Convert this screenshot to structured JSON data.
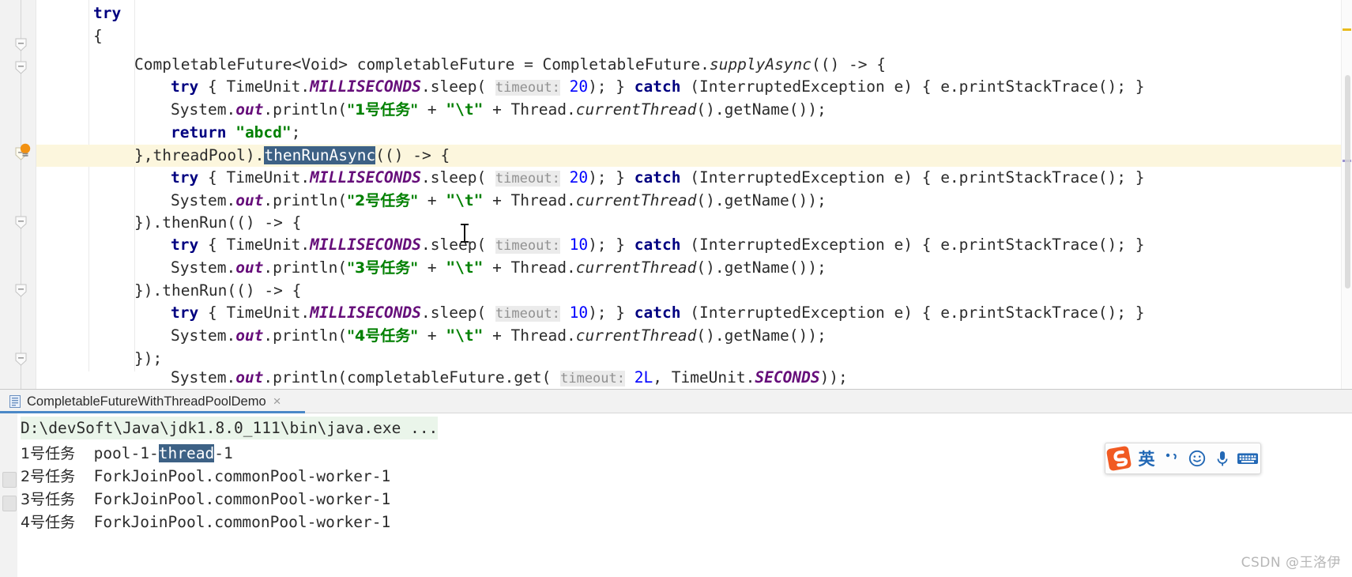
{
  "editor": {
    "highlighted_line_index": 5,
    "selection_token": "thenRunAsync",
    "lines": [
      {
        "indent": 2,
        "text": "try"
      },
      {
        "indent": 2,
        "text": "{"
      },
      {
        "indent": 3,
        "text": "CompletableFuture<Void> completableFuture = CompletableFuture.supplyAsync(() -> {"
      },
      {
        "indent": 4,
        "text": "try { TimeUnit.MILLISECONDS.sleep( timeout: 20); } catch (InterruptedException e) { e.printStackTrace(); }"
      },
      {
        "indent": 4,
        "text": "System.out.println(\"1号任务\" + \"\\t\" + Thread.currentThread().getName());"
      },
      {
        "indent": 4,
        "text": "return \"abcd\";"
      },
      {
        "indent": 3,
        "text": "},threadPool).thenRunAsync(() -> {"
      },
      {
        "indent": 4,
        "text": "try { TimeUnit.MILLISECONDS.sleep( timeout: 20); } catch (InterruptedException e) { e.printStackTrace(); }"
      },
      {
        "indent": 4,
        "text": "System.out.println(\"2号任务\" + \"\\t\" + Thread.currentThread().getName());"
      },
      {
        "indent": 3,
        "text": "}).thenRun(() -> {"
      },
      {
        "indent": 4,
        "text": "try { TimeUnit.MILLISECONDS.sleep( timeout: 10); } catch (InterruptedException e) { e.printStackTrace(); }"
      },
      {
        "indent": 4,
        "text": "System.out.println(\"3号任务\" + \"\\t\" + Thread.currentThread().getName());"
      },
      {
        "indent": 3,
        "text": "}).thenRun(() -> {"
      },
      {
        "indent": 4,
        "text": "try { TimeUnit.MILLISECONDS.sleep( timeout: 10); } catch (InterruptedException e) { e.printStackTrace(); }"
      },
      {
        "indent": 4,
        "text": "System.out.println(\"4号任务\" + \"\\t\" + Thread.currentThread().getName());"
      },
      {
        "indent": 3,
        "text": "});"
      },
      {
        "indent": 3,
        "text": "System.out.println(completableFuture.get( timeout: 2L, TimeUnit.SECONDS));"
      }
    ],
    "parameter_hints": [
      "timeout:",
      "timeout:",
      "timeout:",
      "timeout:",
      "timeout:"
    ],
    "gutter": {
      "fold_markers": [
        "collapse",
        "collapse",
        "collapse",
        "collapse",
        "collapse",
        "collapse"
      ],
      "intention_icon": "lightbulb-icon"
    },
    "colors": {
      "keyword": "#000080",
      "string": "#008000",
      "number": "#0000ff",
      "field": "#660e7a",
      "selection": "#3d6185",
      "highlight_line": "#fcf6dd",
      "hint_background": "#ebebeb"
    }
  },
  "console": {
    "tab": {
      "label": "CompletableFutureWithThreadPoolDemo",
      "close_label": "×",
      "icon": "console-run-icon"
    },
    "output": [
      {
        "text": "D:\\devSoft\\Java\\jdk1.8.0_111\\bin\\java.exe ...",
        "kind": "command"
      },
      {
        "prefix": "1号任务",
        "value_before": "pool-1-",
        "value_selected": "thread",
        "value_after": "-1",
        "kind": "selected"
      },
      {
        "prefix": "2号任务",
        "value": "ForkJoinPool.commonPool-worker-1",
        "kind": "plain"
      },
      {
        "prefix": "3号任务",
        "value": "ForkJoinPool.commonPool-worker-1",
        "kind": "plain"
      },
      {
        "prefix": "4号任务",
        "value": "ForkJoinPool.commonPool-worker-1",
        "kind": "plain"
      }
    ],
    "selection_token": "thread"
  },
  "ime": {
    "name": "sogou-ime",
    "logo": "S",
    "mode_label": "英",
    "items": [
      {
        "icon": "punctuation-icon",
        "label": "’,"
      },
      {
        "icon": "emoji-icon",
        "label": "☺"
      },
      {
        "icon": "microphone-icon",
        "label": "⬛"
      },
      {
        "icon": "keyboard-icon",
        "label": "⌨"
      }
    ]
  },
  "watermark": {
    "text": "CSDN @王洛伊"
  }
}
